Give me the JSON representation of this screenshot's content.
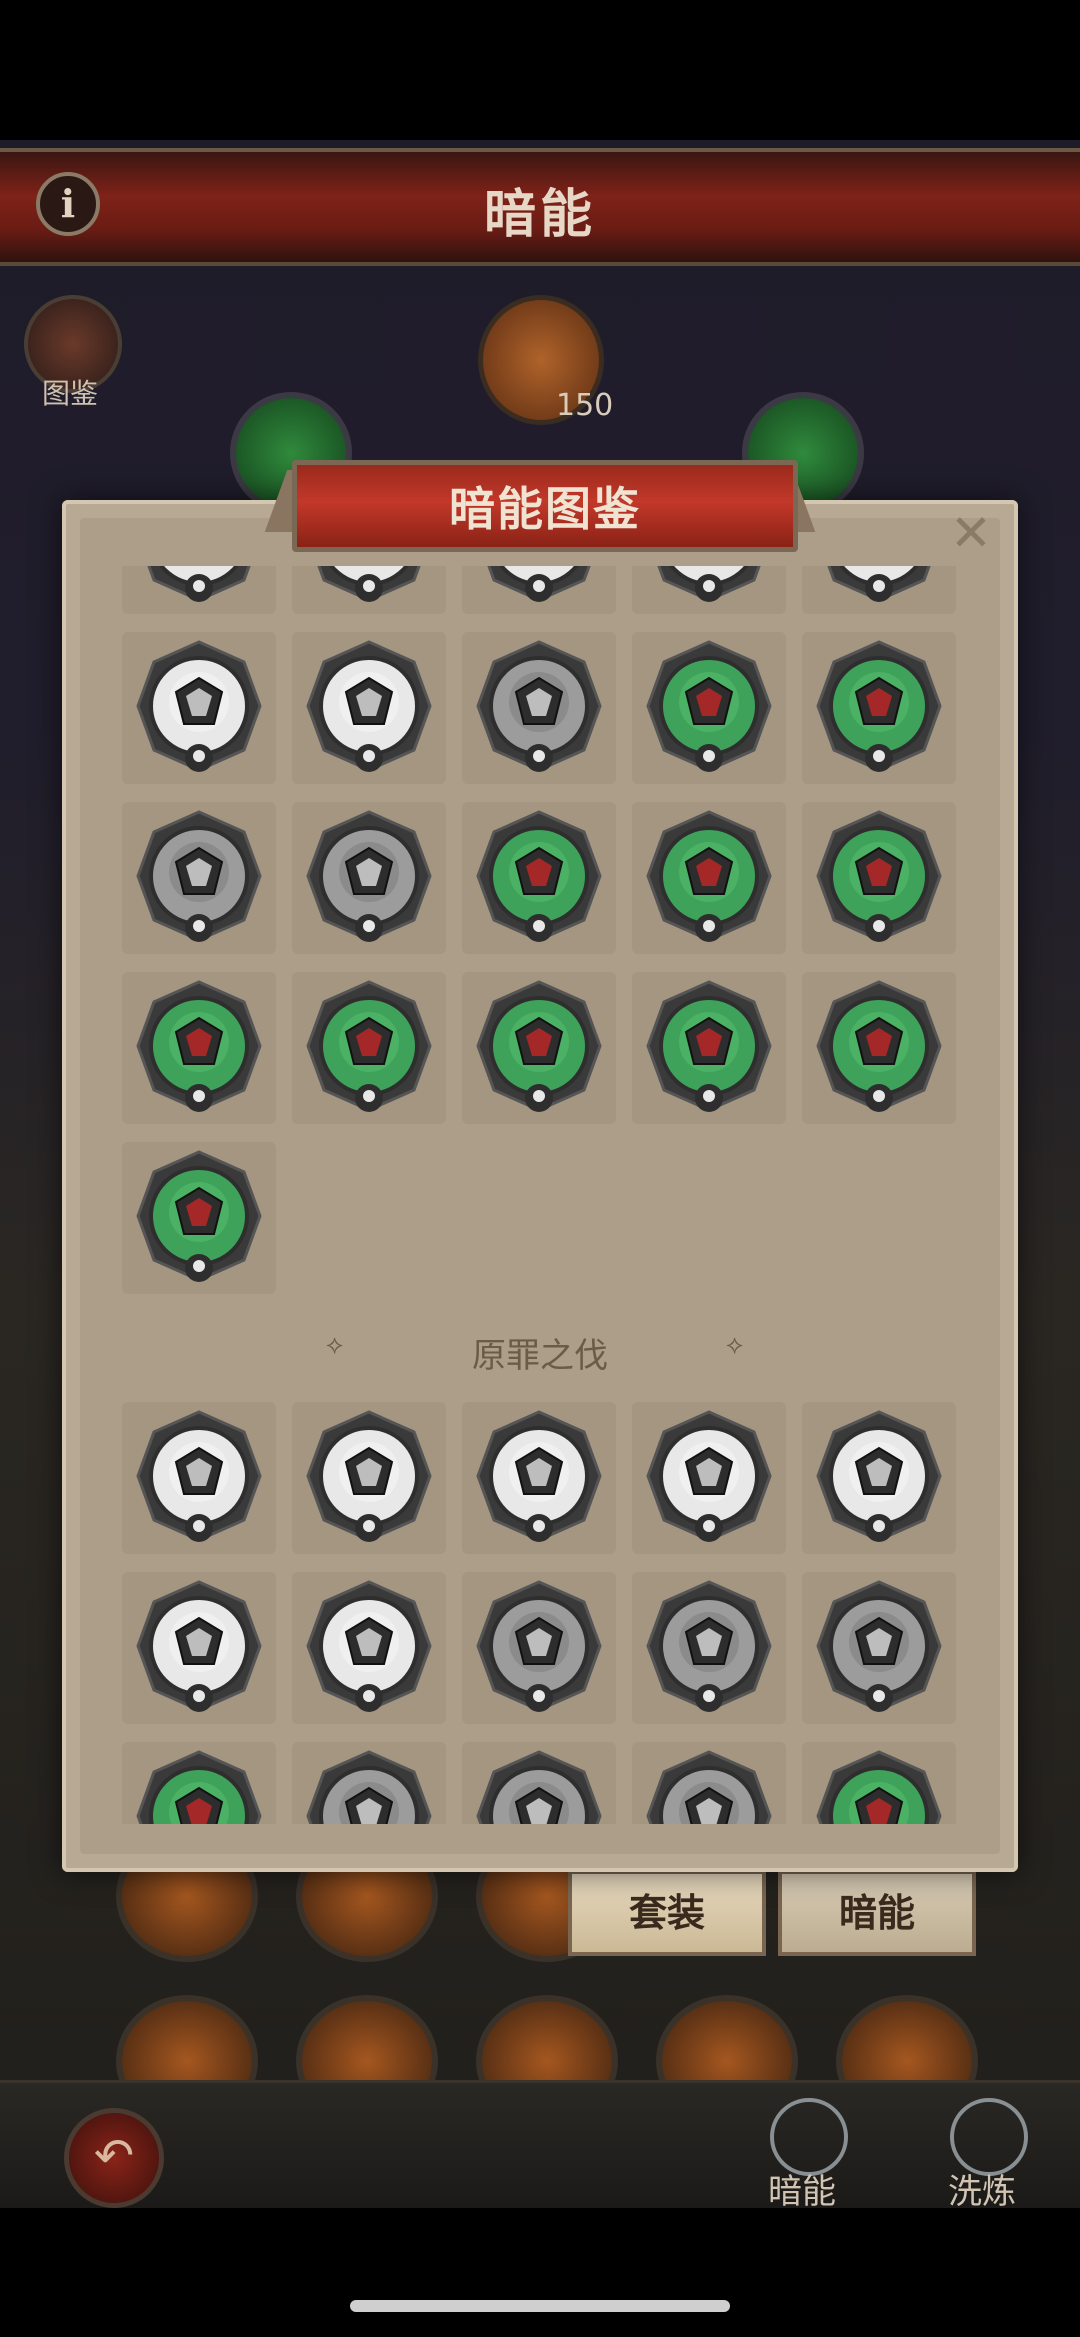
{
  "header": {
    "title": "暗能",
    "info_icon": "info-icon"
  },
  "left_panel": {
    "codex_label": "图鉴"
  },
  "hub": {
    "count": "150"
  },
  "modal": {
    "title": "暗能图鉴",
    "close_icon": "close-icon",
    "section1": {
      "name": "",
      "partial_row_count": 5,
      "items": [
        {
          "state": "white",
          "item": "gauntlet"
        },
        {
          "state": "white",
          "item": "wings-helm"
        },
        {
          "state": "gray",
          "item": "horned-helm"
        },
        {
          "state": "green",
          "item": "horn-pauldron"
        },
        {
          "state": "green",
          "item": "red-chest"
        },
        {
          "state": "gray",
          "item": "gauntlet"
        },
        {
          "state": "gray",
          "item": "greaves"
        },
        {
          "state": "green",
          "item": "red-gauntlet"
        },
        {
          "state": "green",
          "item": "winged-helm"
        },
        {
          "state": "green",
          "item": "horned-helm"
        },
        {
          "state": "green",
          "item": "horn-pauldron"
        },
        {
          "state": "green",
          "item": "red-chest"
        },
        {
          "state": "green",
          "item": "red-boot"
        },
        {
          "state": "green",
          "item": "red-greaves"
        },
        {
          "state": "green",
          "item": "red-gauntlet"
        },
        {
          "state": "green",
          "item": "red-crown"
        }
      ]
    },
    "section2": {
      "name": "原罪之伐",
      "items": [
        {
          "state": "white",
          "item": "spiked-helm"
        },
        {
          "state": "white",
          "item": "horned-helm"
        },
        {
          "state": "white",
          "item": "chest"
        },
        {
          "state": "white",
          "item": "gauntlet"
        },
        {
          "state": "white",
          "item": "greaves"
        },
        {
          "state": "white",
          "item": "pauldrons"
        },
        {
          "state": "white",
          "item": "wings"
        },
        {
          "state": "gray",
          "item": "spiked-helm"
        },
        {
          "state": "gray",
          "item": "horned-helm"
        },
        {
          "state": "gray",
          "item": "chest"
        },
        {
          "state": "green",
          "item": "purple-helm"
        },
        {
          "state": "gray",
          "item": "chest"
        },
        {
          "state": "gray",
          "item": "pauldrons"
        },
        {
          "state": "gray",
          "item": "wings"
        },
        {
          "state": "green",
          "item": "purple-chest"
        }
      ]
    }
  },
  "tabs": {
    "set_label": "套装",
    "dark_label": "暗能"
  },
  "bottom_nav": {
    "back_icon": "back-arrow-icon",
    "dark_label": "暗能",
    "refine_label": "洗炼"
  },
  "colors": {
    "green": "#3fa25a",
    "white": "#e6e6e6",
    "gray": "#9a9a9a",
    "banner": "#b8322a"
  }
}
